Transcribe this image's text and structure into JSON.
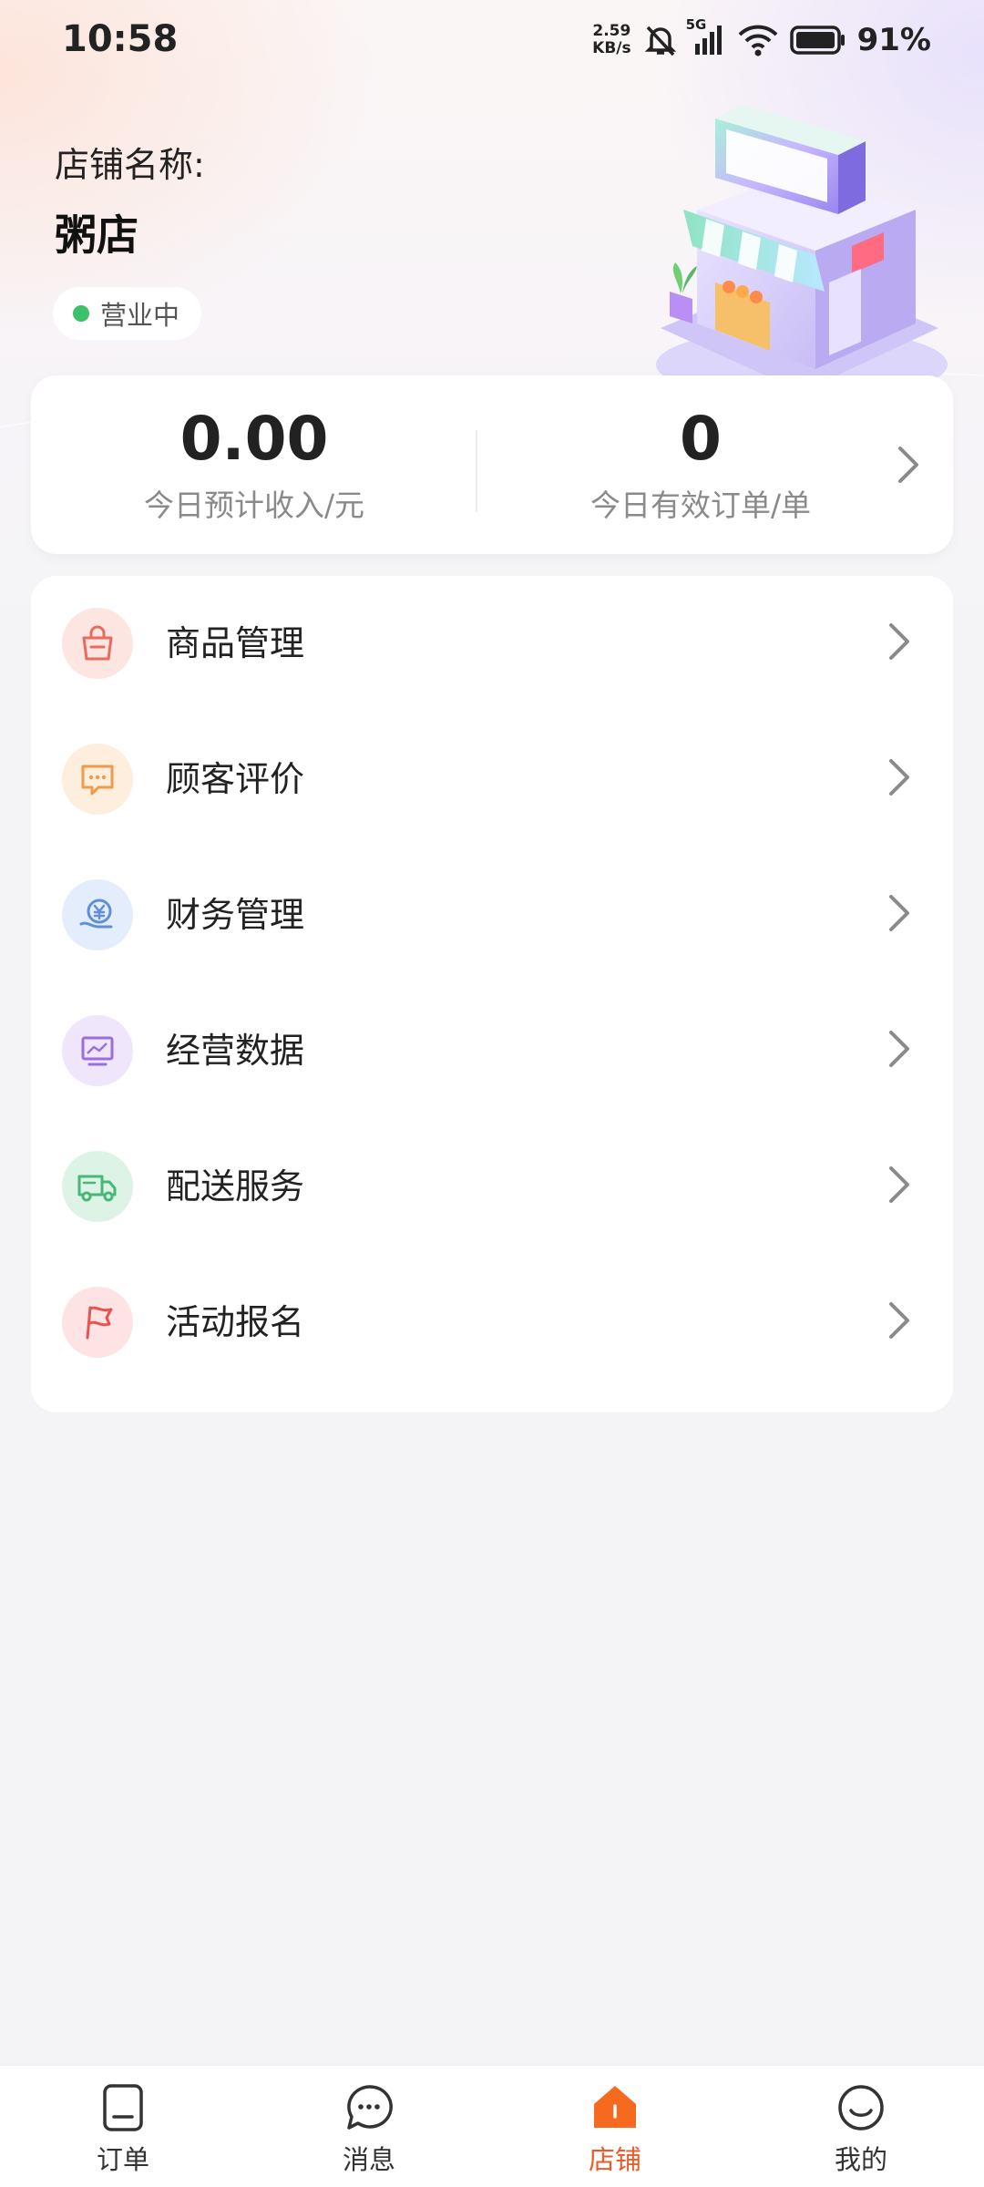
{
  "status_bar": {
    "time": "10:58",
    "net_speed_value": "2.59",
    "net_speed_unit": "KB/s",
    "network": "5G",
    "battery": "91%"
  },
  "store": {
    "label": "店铺名称:",
    "name": "粥店",
    "status": "营业中",
    "status_color": "#3cc06a"
  },
  "stats": {
    "income_value": "0.00",
    "income_label": "今日预计收入/元",
    "orders_value": "0",
    "orders_label": "今日有效订单/单"
  },
  "menu": {
    "items": [
      {
        "label": "商品管理",
        "icon": "shopping-bag-icon",
        "bg": "#fde5e2",
        "color": "#ec6a5a"
      },
      {
        "label": "顾客评价",
        "icon": "comment-icon",
        "bg": "#fdeedd",
        "color": "#f09a4a"
      },
      {
        "label": "财务管理",
        "icon": "finance-icon",
        "bg": "#e4edfb",
        "color": "#5f8fdc"
      },
      {
        "label": "经营数据",
        "icon": "data-monitor-icon",
        "bg": "#efe6fb",
        "color": "#9a6fdc"
      },
      {
        "label": "配送服务",
        "icon": "delivery-truck-icon",
        "bg": "#ddf3e6",
        "color": "#47b878"
      },
      {
        "label": "活动报名",
        "icon": "flag-icon",
        "bg": "#fde3e3",
        "color": "#e8534f"
      }
    ]
  },
  "bottom_nav": {
    "items": [
      {
        "label": "订单",
        "icon": "order-icon"
      },
      {
        "label": "消息",
        "icon": "message-icon"
      },
      {
        "label": "店铺",
        "icon": "store-icon",
        "active": true
      },
      {
        "label": "我的",
        "icon": "profile-icon"
      }
    ],
    "active_color": "#f05a28"
  }
}
